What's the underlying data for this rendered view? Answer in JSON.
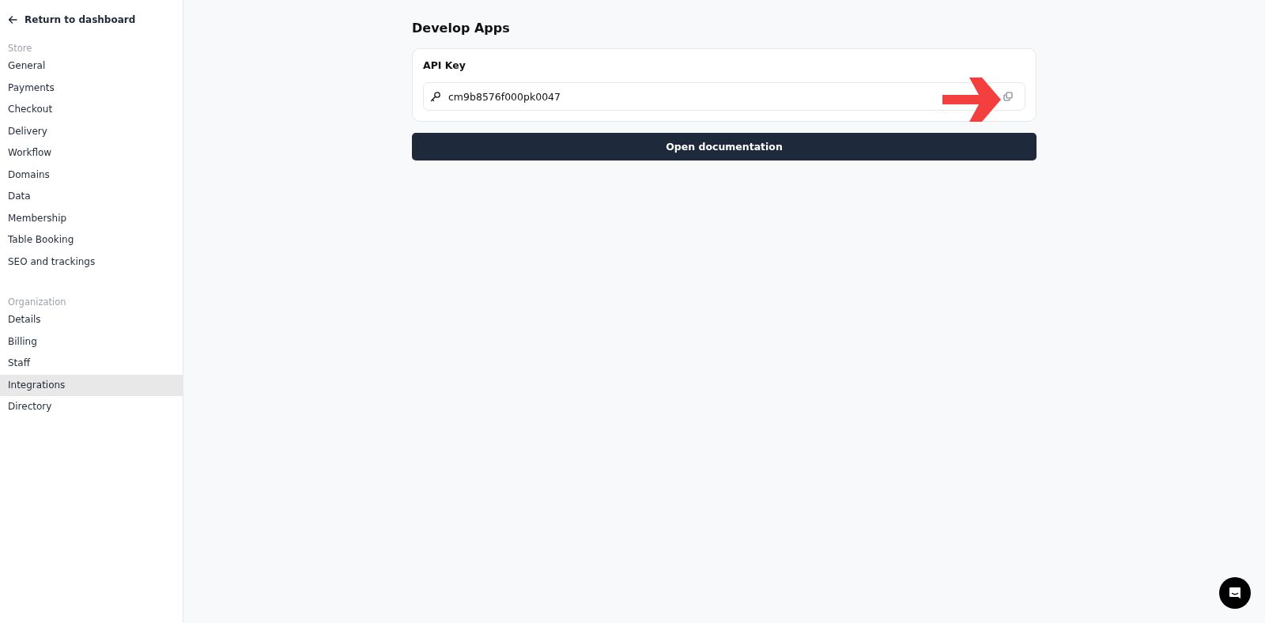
{
  "sidebar": {
    "back_link": "Return to dashboard",
    "sections": [
      {
        "heading": "Store",
        "items": [
          {
            "label": "General",
            "selected": false
          },
          {
            "label": "Payments",
            "selected": false
          },
          {
            "label": "Checkout",
            "selected": false
          },
          {
            "label": "Delivery",
            "selected": false
          },
          {
            "label": "Workflow",
            "selected": false
          },
          {
            "label": "Domains",
            "selected": false
          },
          {
            "label": "Data",
            "selected": false
          },
          {
            "label": "Membership",
            "selected": false
          },
          {
            "label": "Table Booking",
            "selected": false
          },
          {
            "label": "SEO and trackings",
            "selected": false
          }
        ]
      },
      {
        "heading": "Organization",
        "items": [
          {
            "label": "Details",
            "selected": false
          },
          {
            "label": "Billing",
            "selected": false
          },
          {
            "label": "Staff",
            "selected": false
          },
          {
            "label": "Integrations",
            "selected": true
          },
          {
            "label": "Directory",
            "selected": false
          }
        ]
      }
    ]
  },
  "main": {
    "title": "Develop Apps",
    "card": {
      "title": "API Key",
      "value": "cm9b8576f000pk0047"
    },
    "button": "Open documentation"
  }
}
